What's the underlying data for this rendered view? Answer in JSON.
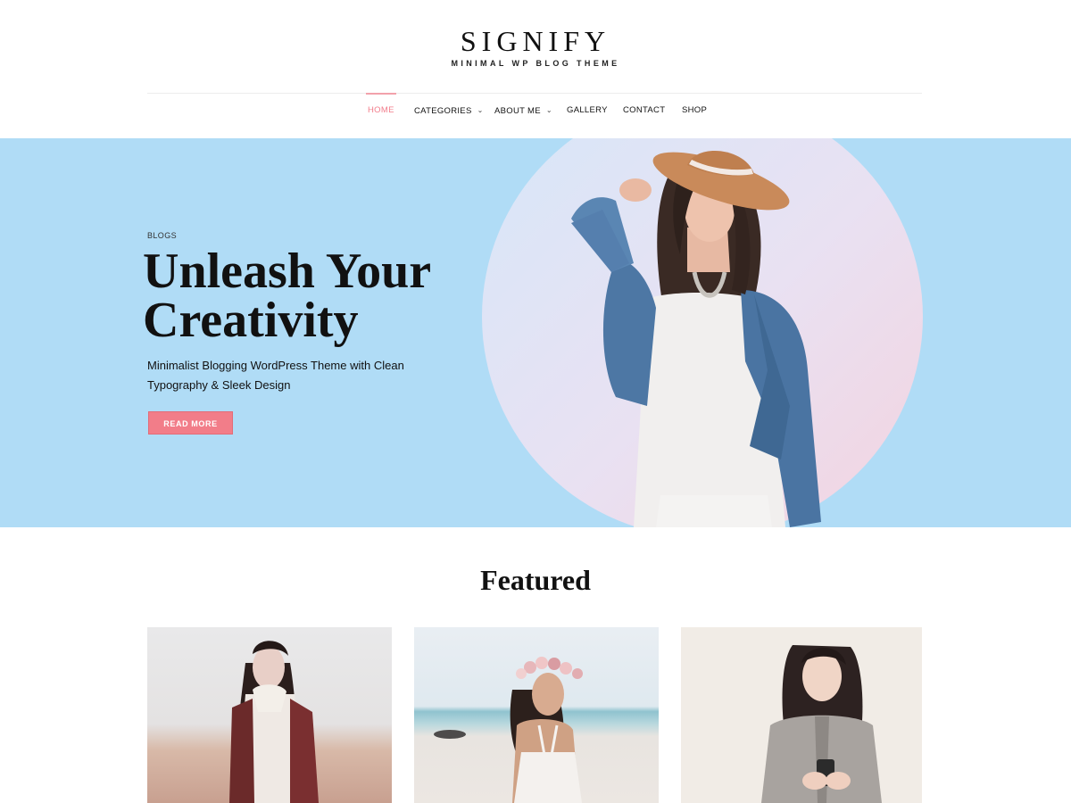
{
  "site": {
    "logo": "SIGNIFY",
    "tagline": "MINIMAL WP BLOG THEME"
  },
  "nav": {
    "items": [
      {
        "label": "HOME",
        "active": true,
        "dropdown": false
      },
      {
        "label": "CATEGORIES",
        "active": false,
        "dropdown": true
      },
      {
        "label": "ABOUT ME",
        "active": false,
        "dropdown": true
      },
      {
        "label": "GALLERY",
        "active": false,
        "dropdown": false
      },
      {
        "label": "CONTACT",
        "active": false,
        "dropdown": false
      },
      {
        "label": "SHOP",
        "active": false,
        "dropdown": false
      }
    ]
  },
  "hero": {
    "kicker": "BLOGS",
    "title": "Unleash Your Creativity",
    "subtitle": "Minimalist Blogging WordPress Theme with Clean Typography & Sleek Design",
    "button_label": "READ MORE"
  },
  "featured": {
    "heading": "Featured"
  },
  "colors": {
    "accent": "#f27d89",
    "hero_bg": "#b0dcf6",
    "text": "#111111"
  },
  "icons": {
    "dropdown": "chevron-down-icon"
  }
}
